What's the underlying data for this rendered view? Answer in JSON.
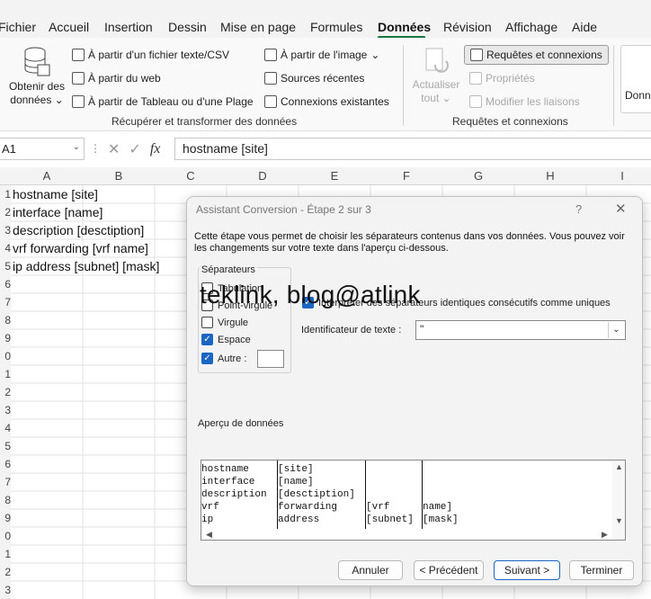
{
  "menu": [
    "Fichier",
    "Accueil",
    "Insertion",
    "Dessin",
    "Mise en page",
    "Formules",
    "Données",
    "Révision",
    "Affichage",
    "Aide"
  ],
  "menu_active": "Données",
  "ribbon": {
    "get_data_label_1": "Obtenir des",
    "get_data_label_2": "données",
    "from_csv": "À partir d'un fichier texte/CSV",
    "from_web": "À partir du web",
    "from_table": "À partir de Tableau ou d'une Plage",
    "from_image": "À partir de l'image",
    "recent_sources": "Sources récentes",
    "existing_connections": "Connexions existantes",
    "group1_label": "Récupérer et transformer des données",
    "refresh_all_1": "Actualiser",
    "refresh_all_2": "tout",
    "queries_connections": "Requêtes et connexions",
    "properties": "Propriétés",
    "edit_links": "Modifier les liaisons",
    "group2_label": "Requêtes et connexions",
    "next_group_partial": "Donn"
  },
  "formula_bar": {
    "name_box": "A1",
    "fx": "fx",
    "formula": "hostname [site]"
  },
  "columns": [
    "A",
    "B",
    "C",
    "D",
    "E",
    "F",
    "G",
    "H",
    "I"
  ],
  "rows": [
    "1",
    "2",
    "3",
    "4",
    "5",
    "6",
    "7",
    "8",
    "9",
    "0",
    "1",
    "2",
    "3",
    "4",
    "5",
    "6",
    "7",
    "8",
    "9",
    "0",
    "1",
    "2",
    "3"
  ],
  "cells": [
    "hostname [site]",
    "interface [name]",
    "description [desctiption]",
    "vrf forwarding [vrf name]",
    "ip address [subnet] [mask]"
  ],
  "dialog": {
    "title": "Assistant Conversion - Étape 2 sur 3",
    "help": "?",
    "close": "✕",
    "description": "Cette étape vous permet de choisir les séparateurs contenus dans vos données. Vous pouvez voir les changements sur votre texte dans l'aperçu ci-dessous.",
    "separators_title": "Séparateurs",
    "separators": [
      {
        "label": "Tabulation",
        "checked": false
      },
      {
        "label": "Point-virgule",
        "checked": false
      },
      {
        "label": "Virgule",
        "checked": false
      },
      {
        "label": "Espace",
        "checked": true
      },
      {
        "label": "Autre :",
        "checked": true
      }
    ],
    "consecutive_label": "Interpréter des séparateurs identiques consécutifs comme uniques",
    "text_qualifier_label": "Identificateur de texte :",
    "text_qualifier_value": "\"",
    "preview_label": "Aperçu de données",
    "preview_rows": [
      [
        "hostname",
        "[site]",
        "",
        ""
      ],
      [
        "interface",
        "[name]",
        "",
        ""
      ],
      [
        "description",
        "[desctiption]",
        "",
        ""
      ],
      [
        "vrf",
        "forwarding",
        "[vrf",
        "name]"
      ],
      [
        "ip",
        "address",
        "[subnet]",
        "[mask]"
      ]
    ],
    "buttons": {
      "cancel": "Annuler",
      "prev": "< Précédent",
      "next": "Suivant >",
      "finish": "Terminer"
    }
  },
  "watermark": "teklink, blog@atlink"
}
